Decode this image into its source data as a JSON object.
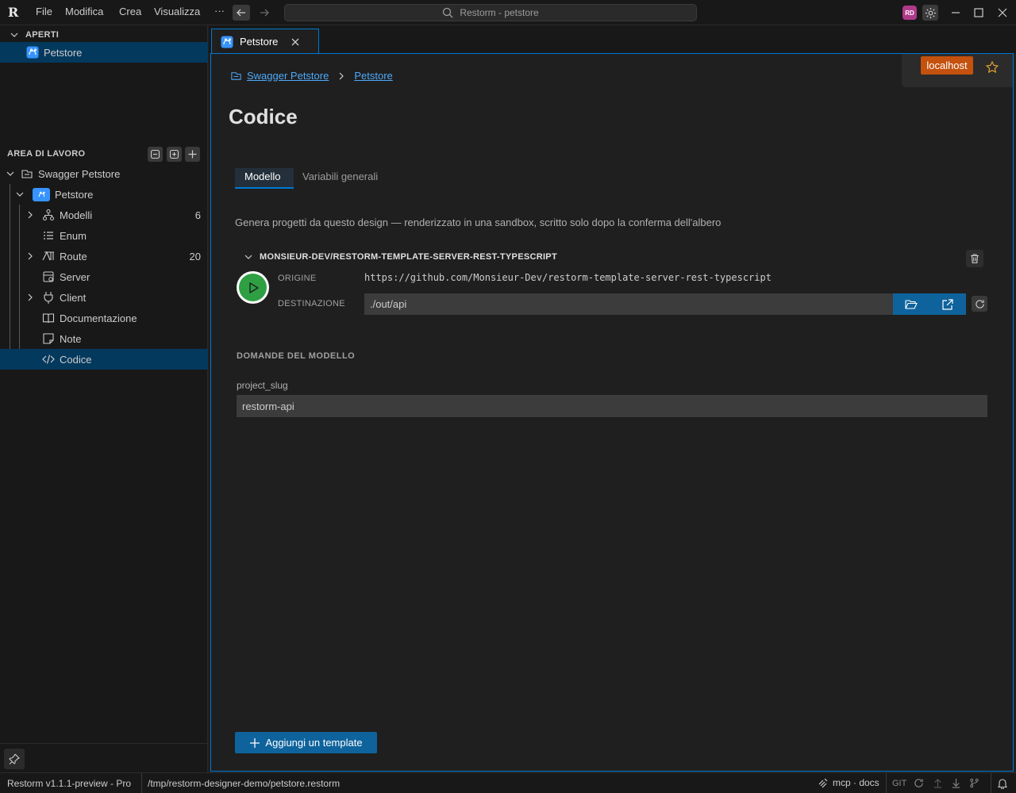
{
  "titlebar": {
    "logo": "R",
    "menu": [
      "File",
      "Modifica",
      "Crea",
      "Visualizza"
    ],
    "more": "···",
    "search_text": "Restorm - petstore",
    "avatar_initials": "RD"
  },
  "sidebar": {
    "open_header": "APERTI",
    "open_items": [
      {
        "label": "Petstore",
        "icon": "petstore-icon"
      }
    ],
    "workspace_header": "AREA DI LAVORO",
    "tree": {
      "root": "Swagger Petstore",
      "project": "Petstore",
      "items": [
        {
          "label": "Modelli",
          "count": "6",
          "icon": "models-icon",
          "expandable": true
        },
        {
          "label": "Enum",
          "count": "",
          "icon": "enum-icon",
          "expandable": false
        },
        {
          "label": "Route",
          "count": "20",
          "icon": "route-icon",
          "expandable": true
        },
        {
          "label": "Server",
          "count": "",
          "icon": "server-icon",
          "expandable": false
        },
        {
          "label": "Client",
          "count": "",
          "icon": "plug-icon",
          "expandable": true
        },
        {
          "label": "Documentazione",
          "count": "",
          "icon": "book-icon",
          "expandable": false
        },
        {
          "label": "Note",
          "count": "",
          "icon": "note-icon",
          "expandable": false
        },
        {
          "label": "Codice",
          "count": "",
          "icon": "code-icon",
          "expandable": false
        }
      ]
    }
  },
  "tab": {
    "label": "Petstore"
  },
  "breadcrumb": {
    "root": "Swagger Petstore",
    "current": "Petstore"
  },
  "env": {
    "badge": "localhost"
  },
  "page": {
    "title": "Codice",
    "tabs": [
      "Modello",
      "Variabili generali"
    ],
    "description": "Genera progetti da questo design — renderizzato in una sandbox, scritto solo dopo la conferma dell'albero"
  },
  "template": {
    "name": "MONSIEUR-DEV/RESTORM-TEMPLATE-SERVER-REST-TYPESCRIPT",
    "origin_label": "ORIGINE",
    "origin_value": "https://github.com/Monsieur-Dev/restorm-template-server-rest-typescript",
    "dest_label": "DESTINAZIONE",
    "dest_value": "./out/api"
  },
  "questions": {
    "header": "DOMANDE DEL MODELLO",
    "field_label": "project_slug",
    "field_value": "restorm-api"
  },
  "actions": {
    "add_template": "Aggiungi un template"
  },
  "statusbar": {
    "version": "Restorm v1.1.1-preview - Pro",
    "path": "/tmp/restorm-designer-demo/petstore.restorm",
    "mcp": "mcp · docs",
    "git": "GIT"
  },
  "colors": {
    "accent": "#0078d4",
    "selection": "#04395e",
    "env_badge": "#c4510e",
    "run_green": "#2ea043",
    "button_blue": "#0e639c"
  }
}
